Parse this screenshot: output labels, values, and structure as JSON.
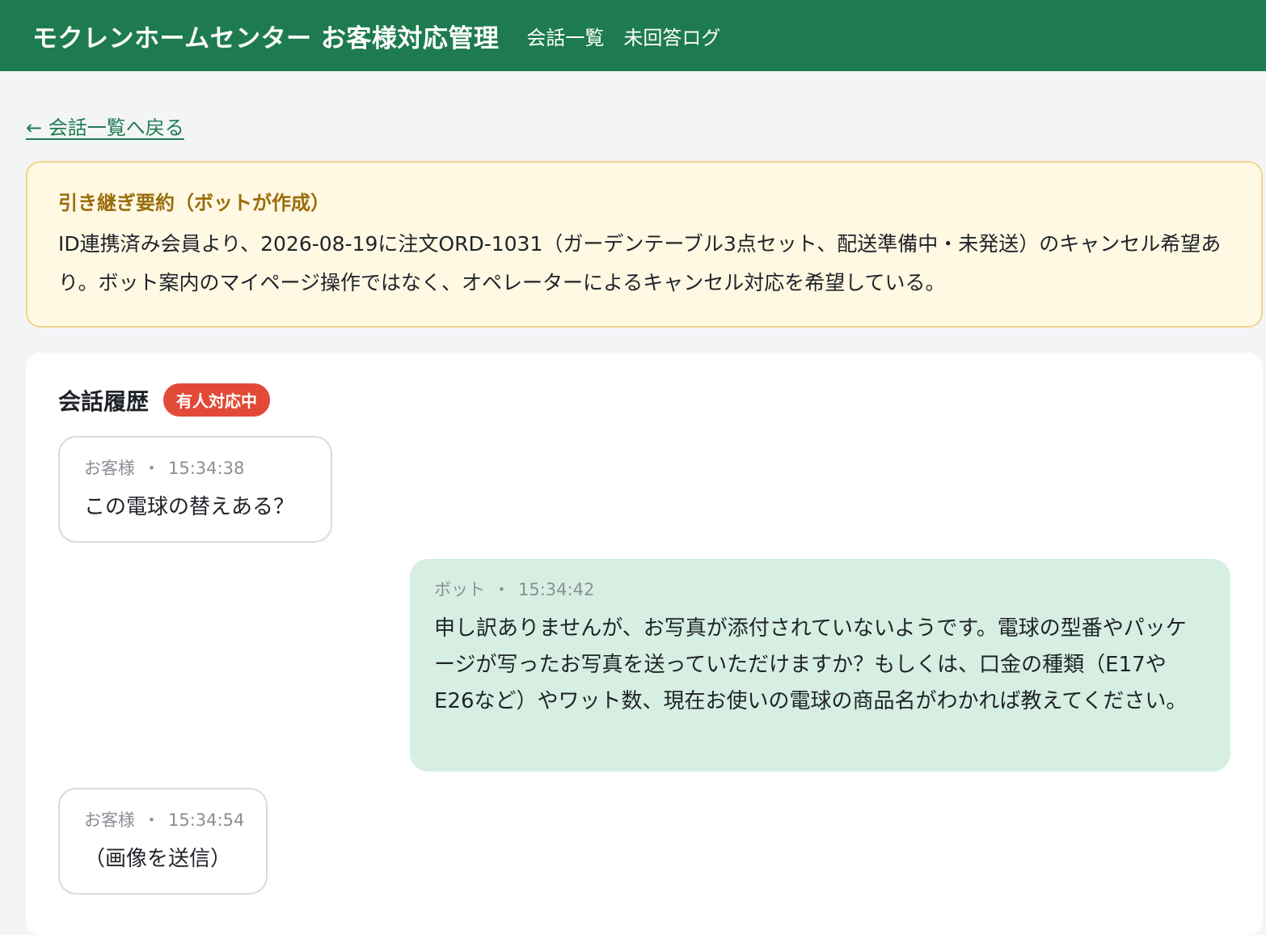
{
  "header": {
    "title": "モクレンホームセンター お客様対応管理",
    "nav": [
      "会話一覧",
      "未回答ログ"
    ]
  },
  "back_link": "← 会話一覧へ戻る",
  "summary": {
    "title": "引き継ぎ要約（ボットが作成）",
    "body": "ID連携済み会員より、2026-08-19に注文ORD-1031（ガーデンテーブル3点セット、配送準備中・未発送）のキャンセル希望あり。ボット案内のマイページ操作ではなく、オペレーターによるキャンセル対応を希望している。"
  },
  "conversation": {
    "title": "会話履歴",
    "badge": "有人対応中",
    "separator": "・",
    "messages": [
      {
        "role": "customer",
        "sender": "お客様",
        "time": "15:34:38",
        "text": "この電球の替えある？"
      },
      {
        "role": "bot",
        "sender": "ボット",
        "time": "15:34:42",
        "text": "申し訳ありませんが、お写真が添付されていないようです。電球の型番やパッケージが写ったお写真を送っていただけますか？もしくは、口金の種類（E17やE26など）やワット数、現在お使いの電球の商品名がわかれば教えてください。"
      },
      {
        "role": "customer",
        "sender": "お客様",
        "time": "15:34:54",
        "text": "（画像を送信）"
      }
    ]
  },
  "colors": {
    "header_bg": "#1e7b4f",
    "summary_bg": "#fff8e3",
    "summary_title": "#9a6d0b",
    "badge_bg": "#e24a37",
    "bot_bubble_bg": "#d6efe2"
  }
}
